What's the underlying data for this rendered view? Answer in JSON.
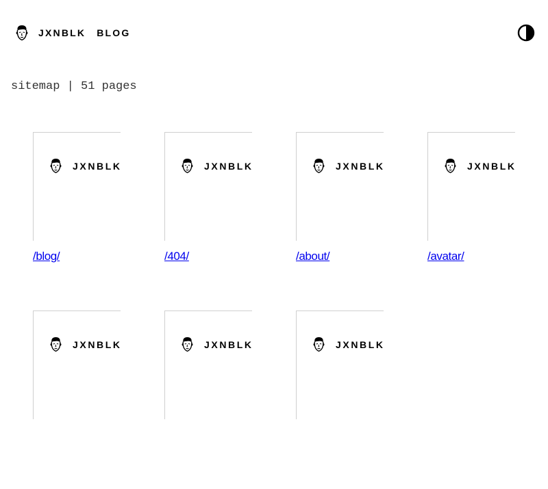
{
  "header": {
    "brand_name": "JXNBLK",
    "brand_section": "BLOG",
    "avatar_icon": "face-avatar-icon",
    "theme_toggle_icon": "contrast-half-circle-icon"
  },
  "sitemap": {
    "title": "sitemap | 51 pages"
  },
  "cards": [
    {
      "thumb_brand": "JXNBLK",
      "link": "/blog/"
    },
    {
      "thumb_brand": "JXNBLK",
      "link": "/404/"
    },
    {
      "thumb_brand": "JXNBLK",
      "link": "/about/"
    },
    {
      "thumb_brand": "JXNBLK",
      "link": "/avatar/"
    },
    {
      "thumb_brand": "JXNBLK",
      "link": ""
    },
    {
      "thumb_brand": "JXNBLK",
      "link": ""
    },
    {
      "thumb_brand": "JXNBLK",
      "link": ""
    }
  ],
  "colors": {
    "link": "#0000ee",
    "text": "#000000",
    "border": "#cfcfcf"
  }
}
